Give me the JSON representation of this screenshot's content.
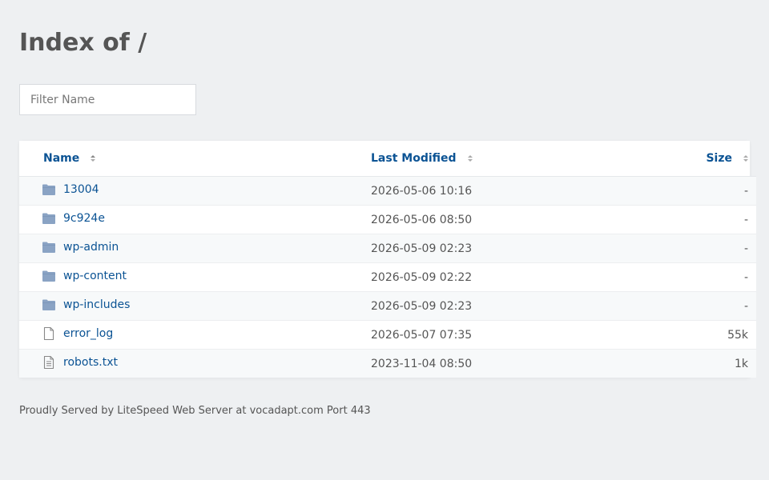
{
  "page": {
    "title": "Index of /"
  },
  "filter": {
    "placeholder": "Filter Name",
    "value": ""
  },
  "table": {
    "columns": {
      "name": "Name",
      "modified": "Last Modified",
      "size": "Size"
    },
    "rows": [
      {
        "type": "folder",
        "name": "13004",
        "modified": "2026-05-06 10:16",
        "size": "-"
      },
      {
        "type": "folder",
        "name": "9c924e",
        "modified": "2026-05-06 08:50",
        "size": "-"
      },
      {
        "type": "folder",
        "name": "wp-admin",
        "modified": "2026-05-09 02:23",
        "size": "-"
      },
      {
        "type": "folder",
        "name": "wp-content",
        "modified": "2026-05-09 02:22",
        "size": "-"
      },
      {
        "type": "folder",
        "name": "wp-includes",
        "modified": "2026-05-09 02:23",
        "size": "-"
      },
      {
        "type": "file",
        "name": "error_log",
        "modified": "2026-05-07 07:35",
        "size": "55k"
      },
      {
        "type": "text-file",
        "name": "robots.txt",
        "modified": "2023-11-04 08:50",
        "size": "1k"
      }
    ]
  },
  "footer": {
    "text": "Proudly Served by LiteSpeed Web Server at vocadapt.com Port 443"
  },
  "colors": {
    "background": "#eef0f2",
    "link": "#0b5394",
    "folder_icon": "#8aa3c4",
    "file_icon": "#888888",
    "text": "#555555"
  },
  "icons": {
    "folder": "folder-icon",
    "file": "file-icon",
    "text-file": "text-file-icon",
    "sort": "sort-icon"
  }
}
